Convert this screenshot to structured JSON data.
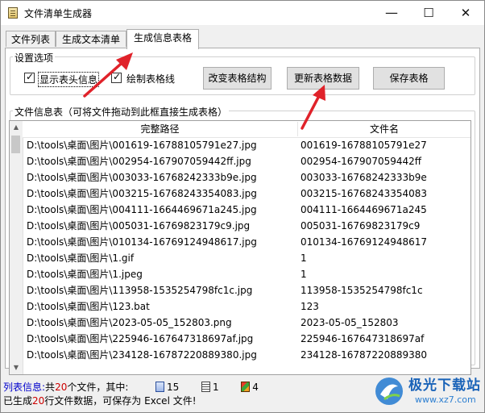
{
  "window": {
    "title": "文件清单生成器",
    "minimize_glyph": "—",
    "maximize_glyph": "☐",
    "close_glyph": "✕"
  },
  "tabs": [
    {
      "label": "文件列表",
      "active": false
    },
    {
      "label": "生成文本清单",
      "active": false
    },
    {
      "label": "生成信息表格",
      "active": true
    }
  ],
  "settings": {
    "group_label": "设置选项",
    "show_header": {
      "label": "显示表头信息",
      "checked": true
    },
    "draw_gridlines": {
      "label": "绘制表格线",
      "checked": true
    },
    "check_glyph": "✓",
    "buttons": {
      "change_structure": "改变表格结构",
      "update_data": "更新表格数据",
      "save_table": "保存表格"
    }
  },
  "info_table": {
    "group_label": "文件信息表（可将文件拖动到此框直接生成表格）",
    "columns": [
      "完整路径",
      "文件名"
    ],
    "rows": [
      [
        "D:\\tools\\桌面\\图片\\001619-16788105791e27.jpg",
        "001619-16788105791e27"
      ],
      [
        "D:\\tools\\桌面\\图片\\002954-167907059442ff.jpg",
        "002954-167907059442ff"
      ],
      [
        "D:\\tools\\桌面\\图片\\003033-16768242333b9e.jpg",
        "003033-16768242333b9e"
      ],
      [
        "D:\\tools\\桌面\\图片\\003215-16768243354083.jpg",
        "003215-16768243354083"
      ],
      [
        "D:\\tools\\桌面\\图片\\004111-1664469671a245.jpg",
        "004111-1664469671a245"
      ],
      [
        "D:\\tools\\桌面\\图片\\005031-16769823179c9.jpg",
        "005031-16769823179c9"
      ],
      [
        "D:\\tools\\桌面\\图片\\010134-16769124948617.jpg",
        "010134-16769124948617"
      ],
      [
        "D:\\tools\\桌面\\图片\\1.gif",
        "1"
      ],
      [
        "D:\\tools\\桌面\\图片\\1.jpeg",
        "1"
      ],
      [
        "D:\\tools\\桌面\\图片\\113958-1535254798fc1c.jpg",
        "113958-1535254798fc1c"
      ],
      [
        "D:\\tools\\桌面\\图片\\123.bat",
        "123"
      ],
      [
        "D:\\tools\\桌面\\图片\\2023-05-05_152803.png",
        "2023-05-05_152803"
      ],
      [
        "D:\\tools\\桌面\\图片\\225946-167647318697af.jpg",
        "225946-167647318697af"
      ],
      [
        "D:\\tools\\桌面\\图片\\234128-16787220889380.jpg",
        "234128-16787220889380"
      ]
    ]
  },
  "status": {
    "line1_prefix": "列表信息:",
    "line1_gong": "共",
    "file_count": "20",
    "line1_mid": "个文件，其中:",
    "image_count": "15",
    "doc_count": "1",
    "other_count": "4",
    "line2_prefix": "已生成",
    "row_count": "20",
    "line2_suffix": "行文件数据，可保存为 Excel 文件!"
  },
  "watermark": {
    "name": "极光下载站",
    "url": "www.xz7.com"
  },
  "colors": {
    "annotation_arrow": "#e0222a",
    "status_blue": "#0000cc",
    "status_red": "#cc0000"
  }
}
